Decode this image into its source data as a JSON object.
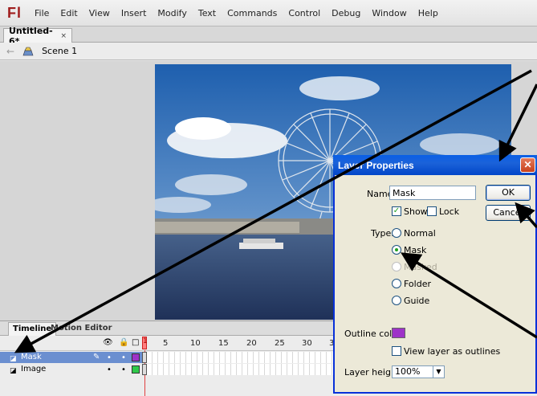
{
  "app": {
    "logo": "Fl"
  },
  "menu": [
    "File",
    "Edit",
    "View",
    "Insert",
    "Modify",
    "Text",
    "Commands",
    "Control",
    "Debug",
    "Window",
    "Help"
  ],
  "document_tab": {
    "title": "Untitled-6*",
    "close": "×"
  },
  "scene": {
    "label": "Scene 1"
  },
  "timeline": {
    "tabs": [
      "Timeline",
      "Motion Editor"
    ],
    "frame_numbers": [
      "5",
      "10",
      "15",
      "20",
      "25",
      "30",
      "3"
    ],
    "playhead_frame": "1",
    "layers": [
      {
        "name": "Mask",
        "color": "#9e33c8",
        "selected": true
      },
      {
        "name": "Image",
        "color": "#2ec94a",
        "selected": false
      }
    ]
  },
  "dialog": {
    "title": "Layer Properties",
    "name_label": "Name:",
    "name_value": "Mask",
    "ok_label": "OK",
    "cancel_label": "Cancel",
    "show_label": "Show",
    "lock_label": "Lock",
    "type_label": "Type:",
    "types": [
      "Normal",
      "Mask",
      "Masked",
      "Folder",
      "Guide"
    ],
    "selected_type": "Mask",
    "outline_color_label": "Outline color:",
    "outline_color": "#9e33c8",
    "view_outlines_label": "View layer as outlines",
    "layer_height_label": "Layer height:",
    "layer_height_value": "100%"
  }
}
